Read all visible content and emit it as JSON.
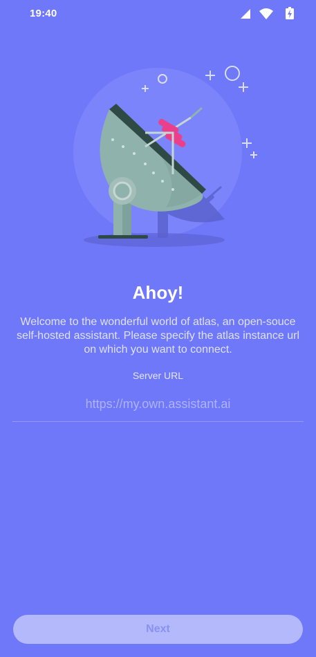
{
  "status_bar": {
    "time": "19:40",
    "icons": [
      "signal-icon",
      "wifi-icon",
      "battery-charging-icon"
    ]
  },
  "illustration": {
    "name": "satellite-dish-illustration"
  },
  "welcome": {
    "title": "Ahoy!",
    "message": "Welcome to the wonderful world of atlas, an open-souce self-hosted assistant. Please specify the atlas instance url on which you want to connect."
  },
  "server_url": {
    "label": "Server URL",
    "value": "",
    "placeholder": "https://my.own.assistant.ai"
  },
  "actions": {
    "next_label": "Next"
  },
  "colors": {
    "background": "#6f78f9",
    "button_background": "#b4b9fc",
    "button_text": "#8a91ef",
    "dish_body": "#8fb3ac",
    "dish_dark": "#2f4a44",
    "accent_pink": "#ea3f8a"
  }
}
